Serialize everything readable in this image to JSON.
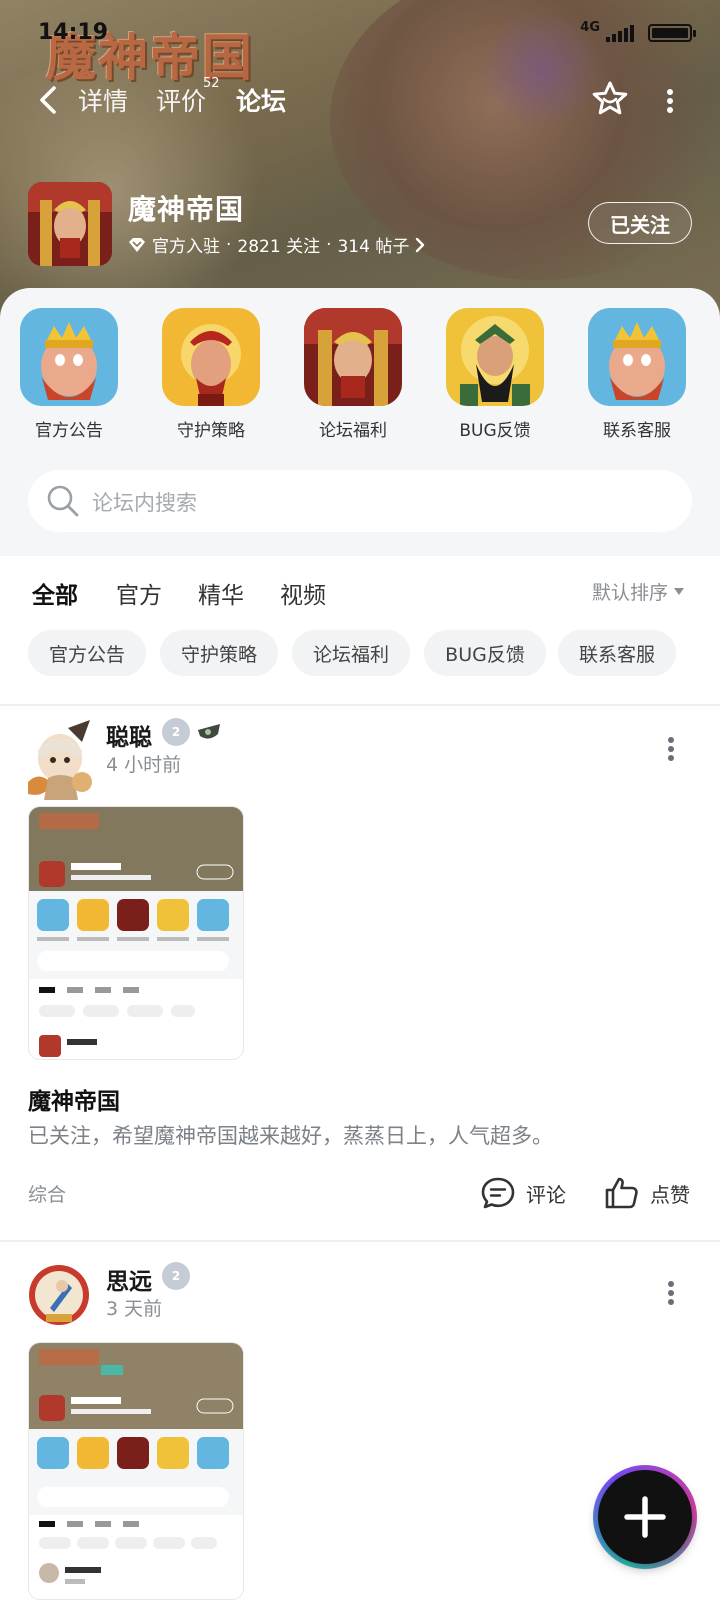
{
  "status_bar": {
    "time": "14:19",
    "network": "4G"
  },
  "banner": {
    "logo_text": "魔神帝国"
  },
  "nav": {
    "tabs": [
      {
        "label": "详情"
      },
      {
        "label": "评价"
      },
      {
        "label": "论坛"
      }
    ],
    "review_badge": "52",
    "active_tab": "论坛"
  },
  "forum": {
    "name": "魔神帝国",
    "official_label": "官方入驻",
    "followers": "2821 关注",
    "posts": "314 帖子",
    "separator": "·",
    "follow_button": "已关注"
  },
  "categories": [
    {
      "label": "官方公告",
      "icon": "bearded-king-icon"
    },
    {
      "label": "守护策略",
      "icon": "red-warrior-icon"
    },
    {
      "label": "论坛福利",
      "icon": "golden-knight-icon"
    },
    {
      "label": "BUG反馈",
      "icon": "black-beard-general-icon"
    },
    {
      "label": "联系客服",
      "icon": "bearded-king-icon"
    }
  ],
  "search": {
    "placeholder": "论坛内搜索"
  },
  "tabs": [
    {
      "label": "全部"
    },
    {
      "label": "官方"
    },
    {
      "label": "精华"
    },
    {
      "label": "视频"
    }
  ],
  "sort": {
    "label": "默认排序"
  },
  "chips": [
    "官方公告",
    "守护策略",
    "论坛福利",
    "BUG反馈",
    "联系客服"
  ],
  "posts": [
    {
      "user": "聪聪",
      "level": "2",
      "time": "4 小时前",
      "title": "魔神帝国",
      "body": "已关注，希望魔神帝国越来越好，蒸蒸日上，人气超多。",
      "tag": "综合",
      "comment_label": "评论",
      "like_label": "点赞"
    },
    {
      "user": "思远",
      "level": "2",
      "time": "3 天前"
    }
  ],
  "colors": {
    "accent": "#2ecdc2",
    "text_primary": "#1a1a1a",
    "text_secondary": "#8a8f95",
    "sheet_bg": "#f4f6f8"
  }
}
